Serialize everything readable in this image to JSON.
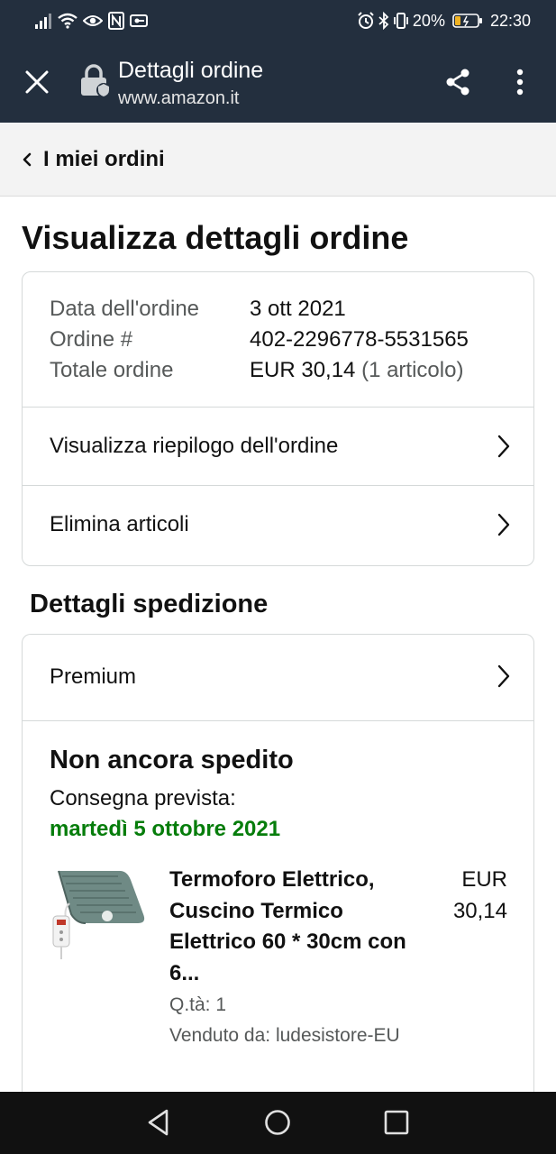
{
  "status_bar": {
    "battery_percent": "20%",
    "time": "22:30",
    "icons_left": [
      "signal-icon",
      "wifi-icon",
      "eye-icon",
      "nfc-icon",
      "vpn-icon"
    ],
    "icons_right": [
      "alarm-icon",
      "bluetooth-icon",
      "vibrate-icon",
      "battery-icon"
    ]
  },
  "browser": {
    "title": "Dettagli ordine",
    "url": "www.amazon.it"
  },
  "breadcrumb": {
    "label": "I miei ordini"
  },
  "page": {
    "title": "Visualizza dettagli ordine"
  },
  "order_summary": {
    "rows": [
      {
        "label": "Data dell'ordine",
        "value": "3 ott 2021",
        "extra": ""
      },
      {
        "label": "Ordine #",
        "value": "402-2296778-5531565",
        "extra": ""
      },
      {
        "label": "Totale ordine",
        "value": "EUR 30,14",
        "extra": " (1 articolo)"
      }
    ],
    "links": [
      {
        "label": "Visualizza riepilogo dell'ordine"
      },
      {
        "label": "Elimina articoli"
      }
    ]
  },
  "shipping": {
    "section_title": "Dettagli spedizione",
    "method": "Premium",
    "status": "Non ancora spedito",
    "delivery_label": "Consegna prevista:",
    "delivery_date": "martedì 5 ottobre 2021",
    "delivery_color": "#067d0b"
  },
  "product": {
    "title": "Termoforo Elettrico, Cuscino Termico Elettrico 60 * 30cm con 6...",
    "price": "EUR 30,14",
    "quantity": "Q.tà: 1",
    "seller": "Venduto da: ludesistore-EU"
  },
  "colors": {
    "header_bg": "#232f3e",
    "breadcrumb_bg": "#f3f3f3",
    "border": "#d5d9d9",
    "muted_text": "#565959"
  }
}
